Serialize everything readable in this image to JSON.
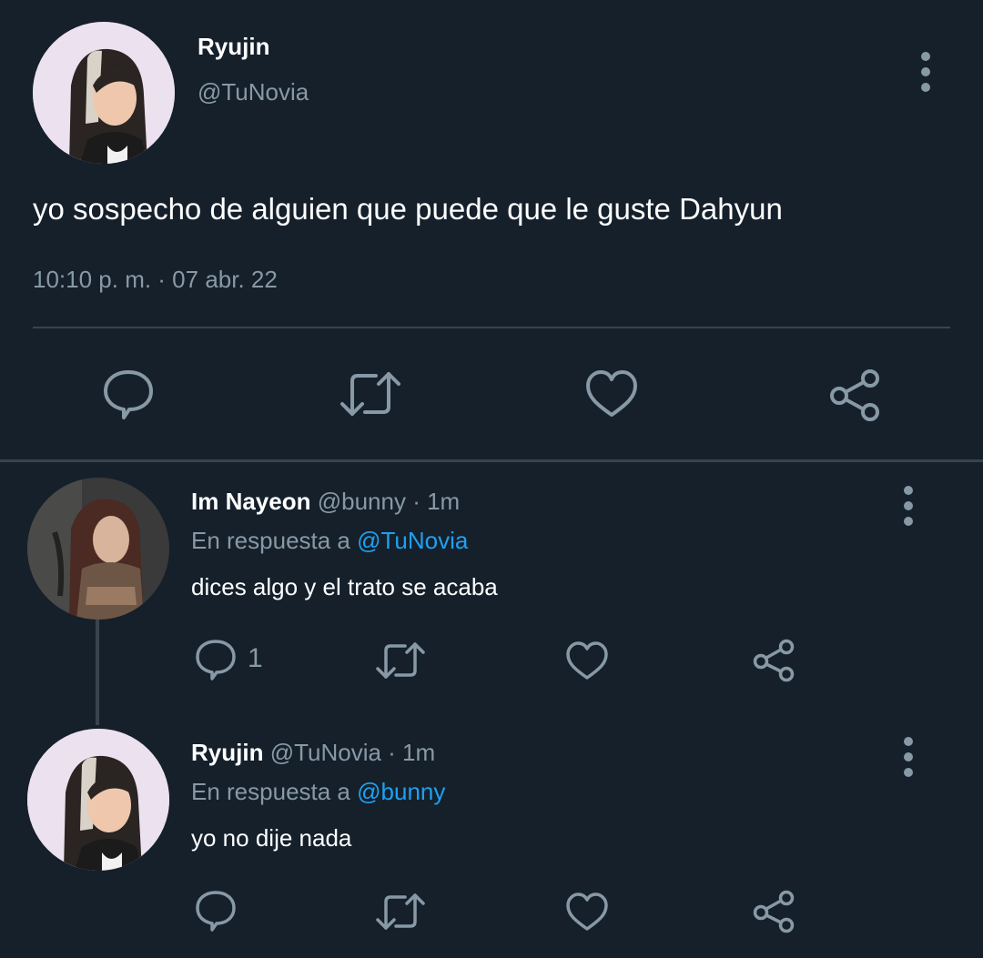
{
  "main_tweet": {
    "display_name": "Ryujin",
    "handle": "@TuNovia",
    "text": "yo sospecho de alguien que puede que le guste Dahyun",
    "timestamp": "10:10 p. m. · 07 abr. 22",
    "actions": [
      "reply-icon",
      "retweet-icon",
      "like-icon",
      "share-icon"
    ]
  },
  "replies": [
    {
      "display_name": "Im Nayeon",
      "handle": "@bunny",
      "time": "· 1m",
      "reply_prefix": "En respuesta a",
      "reply_to": "@TuNovia",
      "text": "dices algo y el trato se acaba",
      "reply_count": "1"
    },
    {
      "display_name": "Ryujin",
      "handle": "@TuNovia",
      "time": "· 1m",
      "reply_prefix": "En respuesta a",
      "reply_to": "@bunny",
      "text": "yo no dije nada",
      "reply_count": ""
    }
  ],
  "colors": {
    "background": "#15202b",
    "muted": "#8899a6",
    "link": "#1da1f2",
    "divider": "#38444d"
  }
}
